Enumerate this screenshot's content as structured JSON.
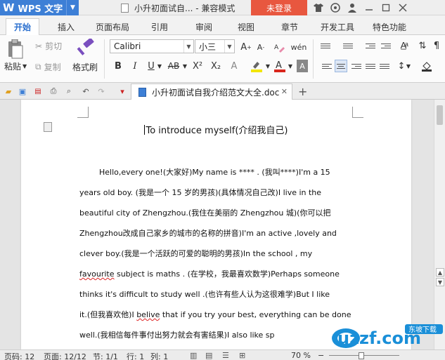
{
  "titlebar": {
    "app_name": "WPS 文字",
    "doc_title": "小升初面试自... - 兼容模式",
    "login_label": "未登录"
  },
  "menu": {
    "tabs": [
      "开始",
      "插入",
      "页面布局",
      "引用",
      "审阅",
      "视图",
      "章节",
      "开发工具",
      "特色功能"
    ],
    "active": "开始"
  },
  "ribbon": {
    "paste": "粘贴",
    "cut": "剪切",
    "copy": "复制",
    "format_painter": "格式刷",
    "font_name": "Calibri",
    "font_size": "小三",
    "bold": "B",
    "italic": "I",
    "underline": "U",
    "strikethrough": "AB",
    "superscript": "X²",
    "subscript": "X₂",
    "font_color_letter": "A",
    "highlight_color": "#f2e600",
    "font_color": "#d9261c"
  },
  "doc_tab": {
    "name": "小升初面试自我介绍范文大全.doc"
  },
  "document": {
    "heading": "To introduce myself(介绍我自己)",
    "lines": [
      "Hello,every one!(大家好)My name is **** . (我叫****)I'm a 15",
      "years old boy. (我是一个 15 岁的男孩)(具体情况自己改)I live in the",
      "beautiful city of Zhengzhou.(我住在美丽的 Zhengzhou 城)(你可以把",
      "Zhengzhou改成自己家乡的城市的名称的拼音)I'm an active ,lovely and",
      "clever boy.(我是一个活跃的可爱的聪明的男孩)In the school , my",
      "favourite subject is maths . (在学校，我最喜欢数学)Perhaps someone",
      "thinks it's difficult to study well .(也许有些人认为这很难学)But I like",
      "it.(但我喜欢他)I belive that if you try your best, everything can be done",
      "well.(我相信每件事付出努力就会有害结果)I also like sp"
    ]
  },
  "statusbar": {
    "page_num": "页码: 12",
    "pages": "页面: 12/12",
    "section": "节: 1/1",
    "row": "行: 1",
    "col": "列: 1",
    "zoom": "70 %"
  },
  "watermark": {
    "text": "uzzf.com",
    "tag": "东坡下载"
  }
}
